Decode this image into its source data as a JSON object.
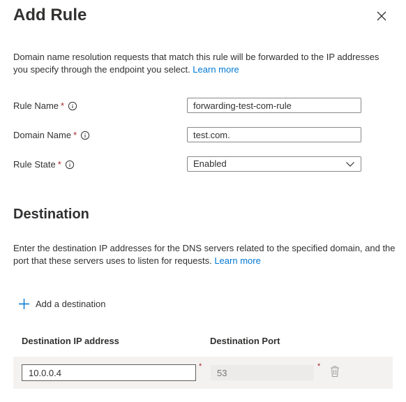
{
  "header": {
    "title": "Add Rule",
    "close_icon": "close-icon"
  },
  "description": {
    "text": "Domain name resolution requests that match this rule will be forwarded to the IP addresses you specify through the endpoint you select.",
    "link": "Learn more"
  },
  "form": {
    "rule_name": {
      "label": "Rule Name",
      "required": "*",
      "value": "forwarding-test-com-rule"
    },
    "domain_name": {
      "label": "Domain Name",
      "required": "*",
      "value": "test.com."
    },
    "rule_state": {
      "label": "Rule State",
      "required": "*",
      "value": "Enabled"
    }
  },
  "destination": {
    "title": "Destination",
    "description": "Enter the destination IP addresses for the DNS servers related to the specified domain, and the port that these servers uses to listen for requests.",
    "link": "Learn more",
    "add_label": "Add a destination",
    "columns": {
      "ip": "Destination IP address",
      "port": "Destination Port"
    },
    "rows": [
      {
        "ip": "10.0.0.4",
        "port_placeholder": "53",
        "required": "*"
      }
    ]
  },
  "colors": {
    "accent": "#0078d4",
    "required": "#a4262c",
    "row_background": "#f3f2f1"
  }
}
